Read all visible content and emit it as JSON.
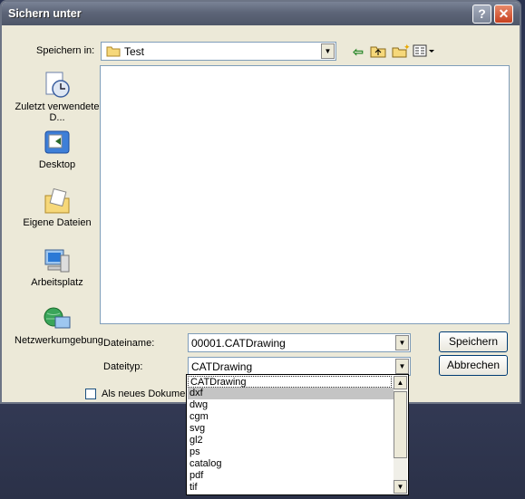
{
  "window": {
    "title": "Sichern unter",
    "help_label": "?",
    "close_label": "✕"
  },
  "toolbar": {
    "save_in_label": "Speichern in:",
    "location": "Test",
    "icons": [
      "back-arrow-icon",
      "up-folder-icon",
      "new-folder-icon",
      "view-menu-icon"
    ]
  },
  "places": [
    {
      "label": "Zuletzt verwendete D...",
      "icon": "recent-documents-icon"
    },
    {
      "label": "Desktop",
      "icon": "desktop-icon"
    },
    {
      "label": "Eigene Dateien",
      "icon": "my-documents-icon"
    },
    {
      "label": "Arbeitsplatz",
      "icon": "my-computer-icon"
    },
    {
      "label": "Netzwerkumgebung",
      "icon": "network-icon"
    }
  ],
  "form": {
    "filename_label": "Dateiname:",
    "filename_value": "00001.CATDrawing",
    "filetype_label": "Dateityp:",
    "filetype_value": "CATDrawing",
    "save_button": "Speichern",
    "cancel_button": "Abbrechen",
    "new_document_checkbox": "Als neues Dokument"
  },
  "dropdown": {
    "options": [
      "CATDrawing",
      "dxf",
      "dwg",
      "cgm",
      "svg",
      "gl2",
      "ps",
      "catalog",
      "pdf",
      "tif"
    ],
    "selected": "dxf"
  }
}
